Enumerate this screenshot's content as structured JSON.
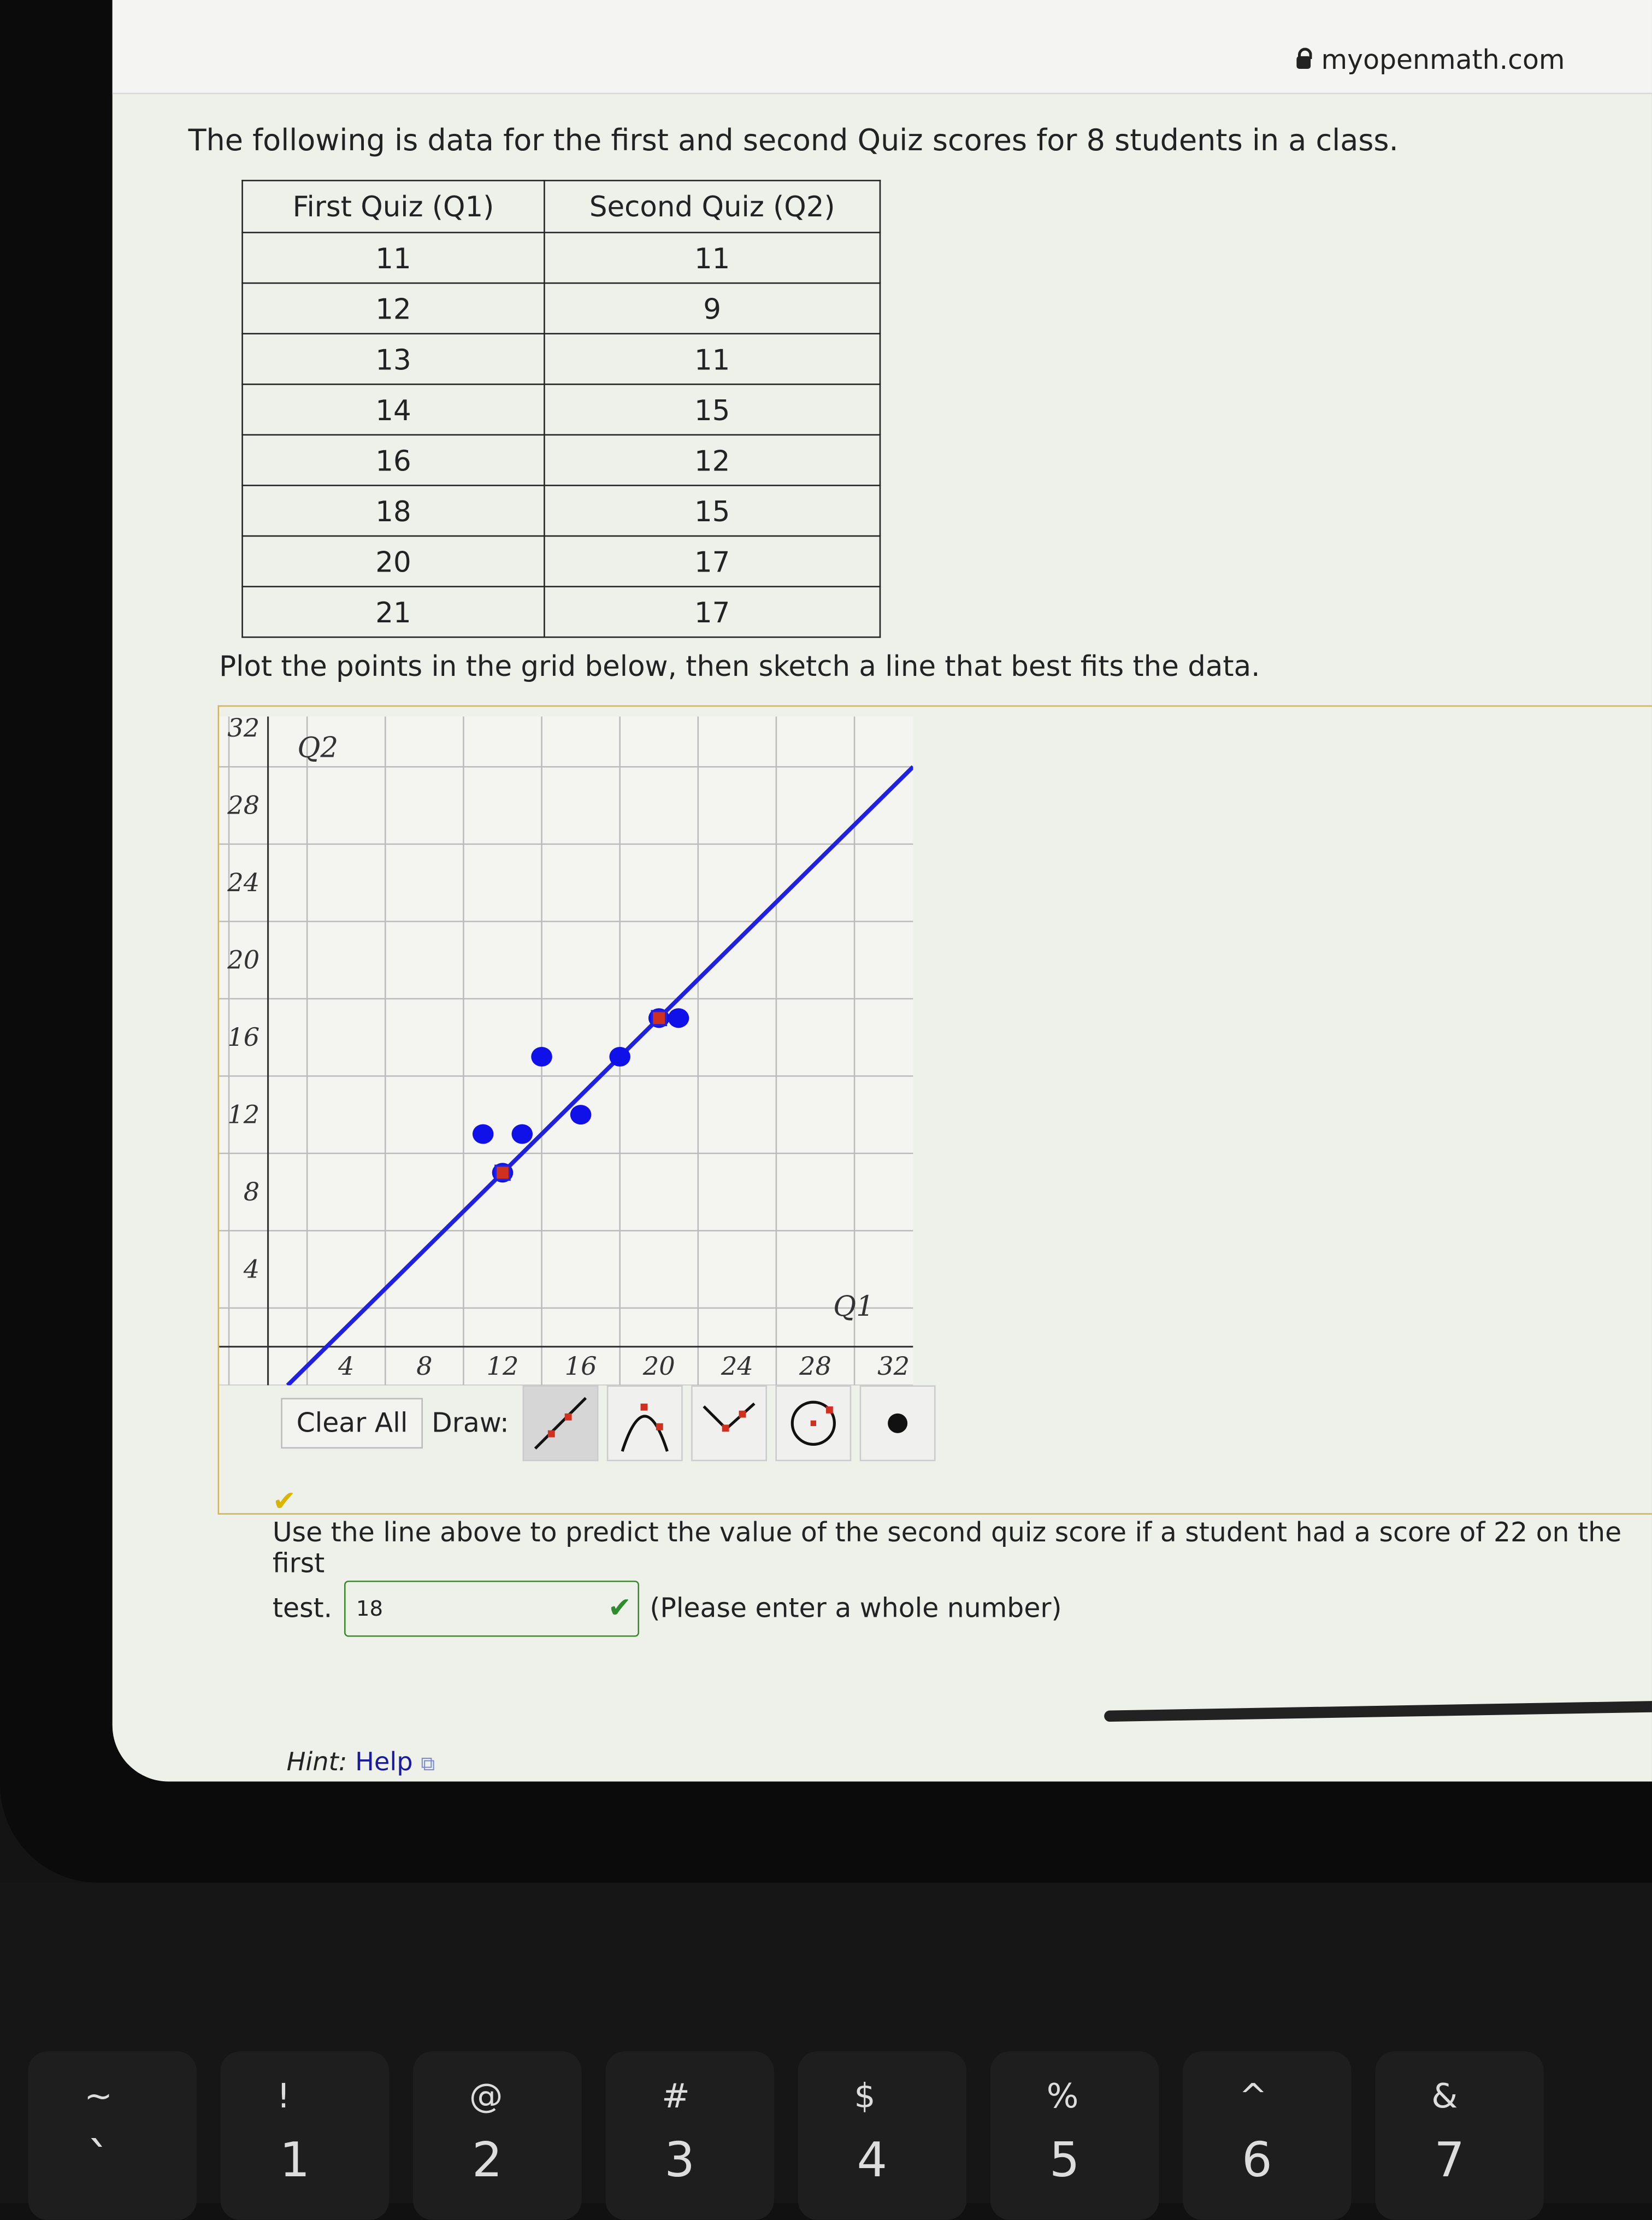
{
  "browser": {
    "url": "myopenmath.com"
  },
  "question": {
    "intro": "The following is data for the first and second Quiz scores for 8 students in a class.",
    "table": {
      "headers": [
        "First Quiz (Q1)",
        "Second Quiz (Q2)"
      ],
      "rows": [
        [
          "11",
          "11"
        ],
        [
          "12",
          "9"
        ],
        [
          "13",
          "11"
        ],
        [
          "14",
          "15"
        ],
        [
          "16",
          "12"
        ],
        [
          "18",
          "15"
        ],
        [
          "20",
          "17"
        ],
        [
          "21",
          "17"
        ]
      ]
    },
    "plot_prompt": "Plot the points in the grid below, then sketch a line that best fits the data.",
    "prediction_prompt": "Use the line above to predict the value of the second quiz score if a student had a score of 22 on the first",
    "prediction_tail": "test.",
    "answer_value": "18",
    "answer_note": "(Please enter a whole number)",
    "hint_label": "Hint:",
    "hint_link": "Help"
  },
  "graph_tools": {
    "clear_all": "Clear All",
    "draw_label": "Draw:",
    "tools": [
      "line-tool-icon",
      "parabola-tool-icon",
      "absolute-value-tool-icon",
      "circle-tool-icon",
      "point-tool-icon"
    ],
    "selected": "line-tool-icon"
  },
  "chart_data": {
    "type": "scatter",
    "xlabel": "Q1",
    "ylabel": "Q2",
    "xlim": [
      0,
      32
    ],
    "ylim": [
      0,
      32
    ],
    "x_ticks": [
      4,
      8,
      12,
      16,
      20,
      24,
      28,
      32
    ],
    "y_ticks": [
      4,
      8,
      12,
      16,
      20,
      24,
      28,
      32
    ],
    "grid": true,
    "points": [
      [
        11,
        11
      ],
      [
        12,
        9
      ],
      [
        13,
        11
      ],
      [
        14,
        15
      ],
      [
        16,
        12
      ],
      [
        18,
        15
      ],
      [
        20,
        17
      ],
      [
        21,
        17
      ]
    ],
    "fit_line": {
      "through": [
        [
          12,
          9
        ],
        [
          20,
          17
        ]
      ],
      "color": "#2020e0"
    },
    "point_color": "#1010e8",
    "anchor_color": "#d03020"
  },
  "keyboard": {
    "keys": [
      {
        "shift": "~",
        "main": "`"
      },
      {
        "shift": "!",
        "main": "1"
      },
      {
        "shift": "@",
        "main": "2"
      },
      {
        "shift": "#",
        "main": "3"
      },
      {
        "shift": "$",
        "main": "4"
      },
      {
        "shift": "%",
        "main": "5"
      },
      {
        "shift": "^",
        "main": "6"
      },
      {
        "shift": "&",
        "main": "7"
      }
    ]
  }
}
